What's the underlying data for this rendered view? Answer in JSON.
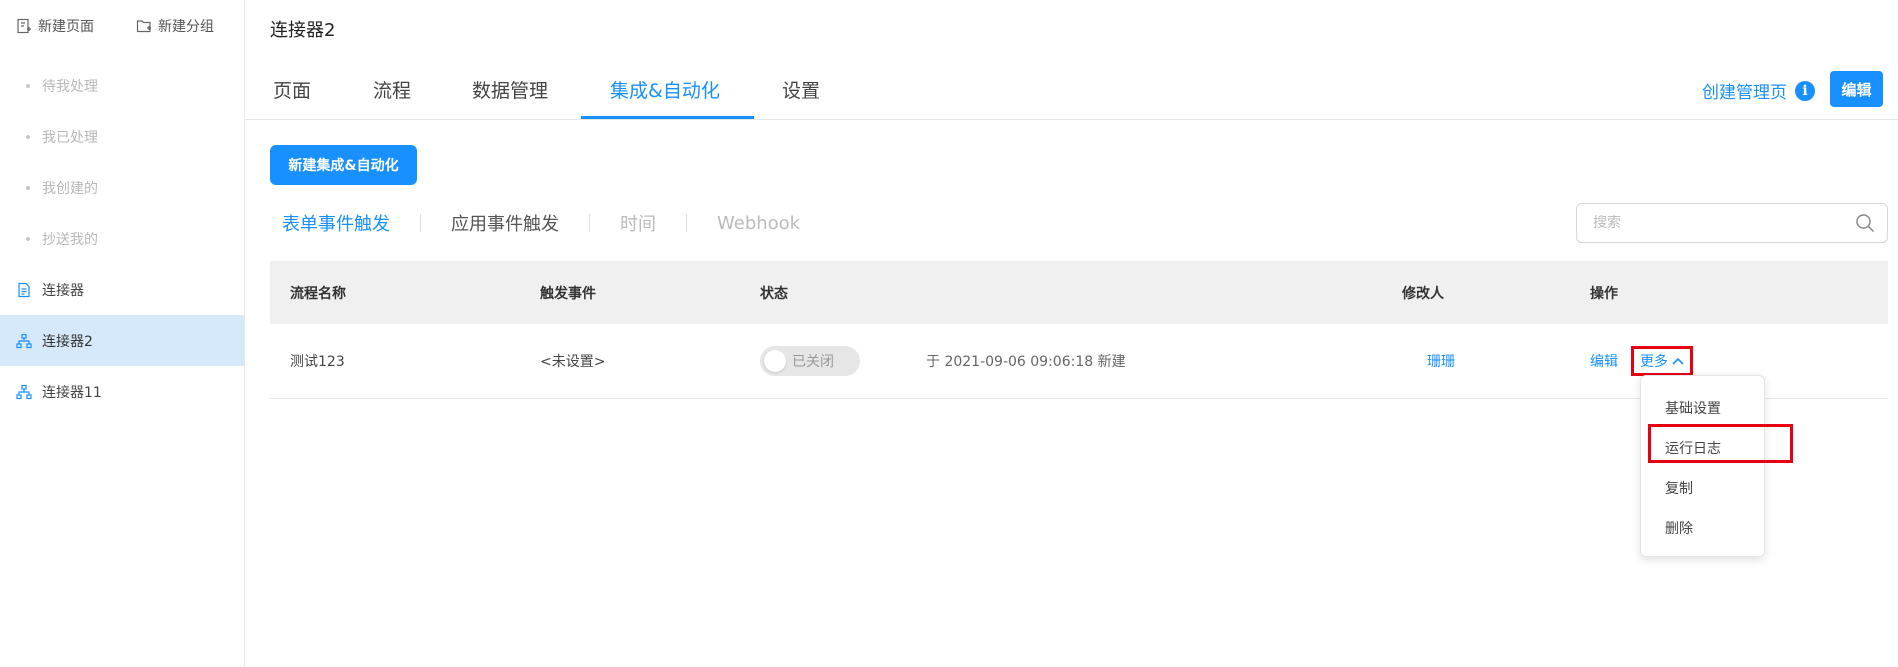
{
  "sidebar": {
    "new_page": "新建页面",
    "new_group": "新建分组",
    "items": [
      {
        "label": "待我处理"
      },
      {
        "label": "我已处理"
      },
      {
        "label": "我创建的"
      },
      {
        "label": "抄送我的"
      },
      {
        "label": "连接器"
      },
      {
        "label": "连接器2"
      },
      {
        "label": "连接器11"
      }
    ]
  },
  "header": {
    "title": "连接器2",
    "tabs": [
      {
        "label": "页面"
      },
      {
        "label": "流程"
      },
      {
        "label": "数据管理"
      },
      {
        "label": "集成&自动化"
      },
      {
        "label": "设置"
      }
    ],
    "create_admin": "创建管理页",
    "edit": "编辑"
  },
  "toolbar": {
    "new_button": "新建集成&自动化",
    "subtabs": [
      {
        "label": "表单事件触发"
      },
      {
        "label": "应用事件触发"
      },
      {
        "label": "时间"
      },
      {
        "label": "Webhook"
      }
    ],
    "search_placeholder": "搜索"
  },
  "table": {
    "columns": [
      "流程名称",
      "触发事件",
      "状态",
      "修改人",
      "操作"
    ],
    "rows": [
      {
        "name": "测试123",
        "trigger": "<未设置>",
        "status": "已关闭",
        "created": "于 2021-09-06 09:06:18 新建",
        "modifier": "珊珊",
        "edit": "编辑",
        "more": "更多"
      }
    ]
  },
  "dropdown": {
    "items": [
      "基础设置",
      "运行日志",
      "复制",
      "删除"
    ]
  },
  "colors": {
    "accent": "#1890ff",
    "highlight": "#e60012"
  }
}
